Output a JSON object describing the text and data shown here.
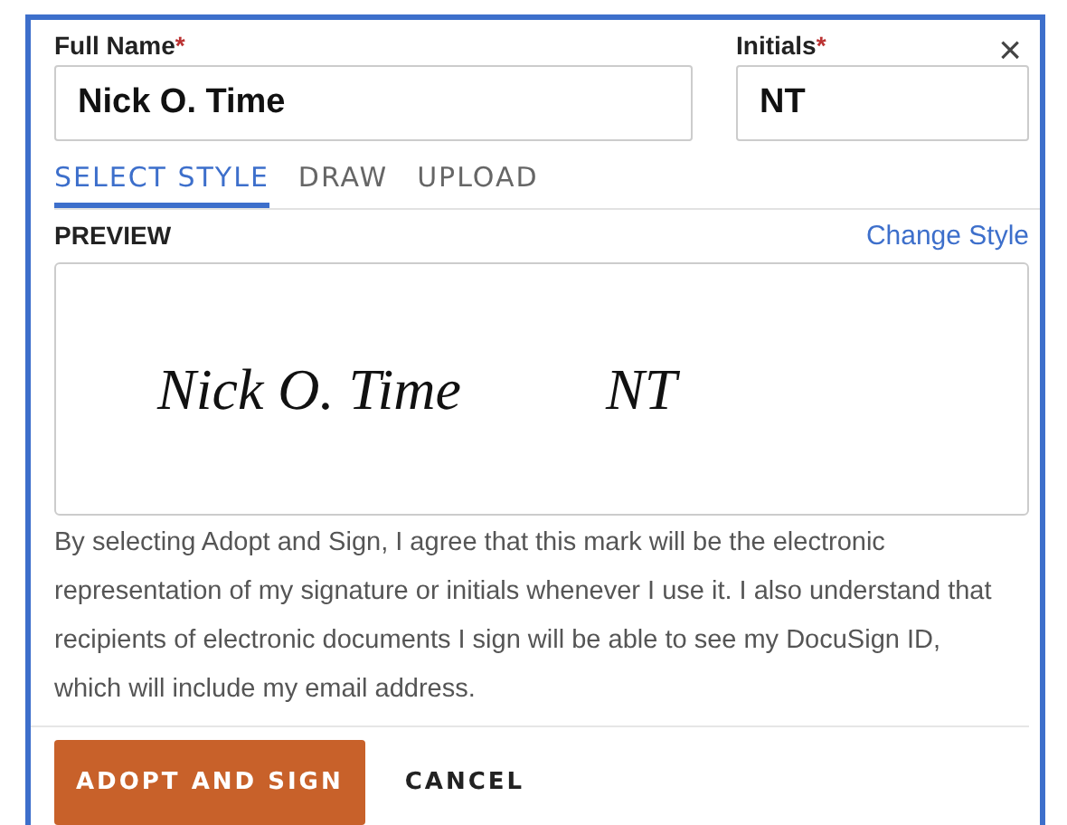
{
  "fields": [
    {
      "label": "Full Name",
      "required_mark": "*",
      "value": "Nick O. Time"
    },
    {
      "label": "Initials",
      "required_mark": "*",
      "value": "NT"
    }
  ],
  "close": "×",
  "tabs": [
    {
      "label": "SELECT STYLE",
      "selected": true
    },
    {
      "label": "DRAW",
      "selected": false
    },
    {
      "label": "UPLOAD",
      "selected": false
    }
  ],
  "preview": {
    "heading": "PREVIEW",
    "link": "Change Style",
    "signature": "Nick O. Time",
    "initials": "NT"
  },
  "notice": "By selecting Adopt and Sign, I agree that this mark will be the electronic representation of my signature or initials whenever I use it. I also understand that recipients of electronic documents I sign will be able to see my DocuSign ID, which will include my email address.",
  "buttons": [
    {
      "label": "ADOPT AND SIGN",
      "kind": "primary"
    },
    {
      "label": "CANCEL",
      "kind": "plain"
    }
  ]
}
